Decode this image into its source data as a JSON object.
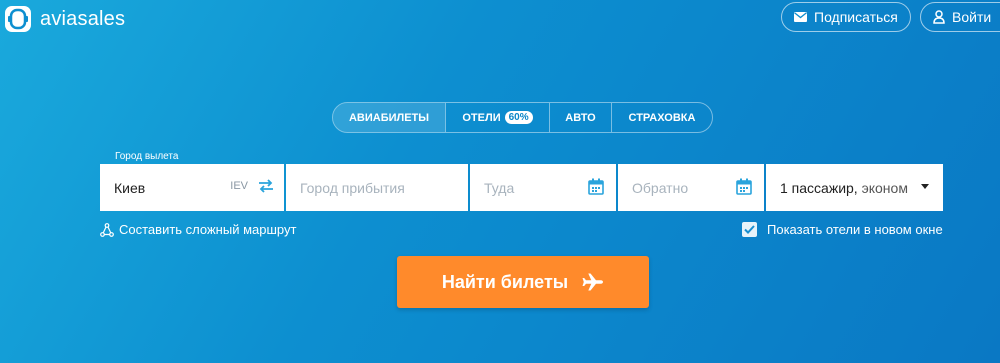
{
  "header": {
    "logo_text": "aviasales",
    "subscribe_label": "Подписаться",
    "login_label": "Войти"
  },
  "tabs": [
    {
      "label": "АВИАБИЛЕТЫ",
      "active": true
    },
    {
      "label": "ОТЕЛИ",
      "badge": "60%",
      "active": false
    },
    {
      "label": "АВТО",
      "active": false
    },
    {
      "label": "СТРАХОВКА",
      "active": false
    }
  ],
  "search": {
    "origin_label": "Город вылета",
    "origin_value": "Киев",
    "origin_iata": "IEV",
    "destination_placeholder": "Город прибытия",
    "depart_placeholder": "Туда",
    "return_placeholder": "Обратно",
    "passengers": "1 пассажир,",
    "cabin_class": "эконом"
  },
  "options": {
    "complex_route_label": "Составить сложный маршрут",
    "show_hotels_label": "Показать отели в новом окне",
    "show_hotels_checked": true
  },
  "cta": {
    "find_label": "Найти билеты"
  },
  "colors": {
    "background": "#0d8fd0",
    "accent_button": "#ff8a2b",
    "icon_blue": "#2aa4dc"
  },
  "icons": {
    "logo": "aviasales-logo-icon",
    "subscribe": "envelope-icon",
    "login": "user-icon",
    "swap": "swap-arrows-icon",
    "calendar": "calendar-icon",
    "route": "route-network-icon",
    "checkbox": "check-icon",
    "cta": "airplane-icon"
  }
}
